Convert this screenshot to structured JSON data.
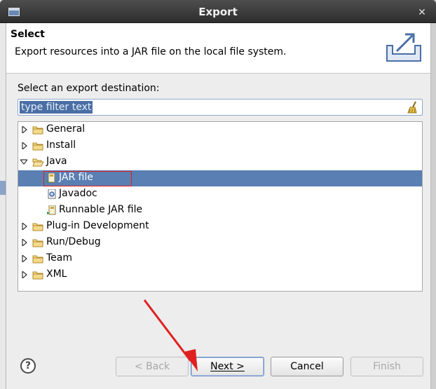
{
  "window": {
    "title": "Export"
  },
  "header": {
    "title": "Select",
    "description": "Export resources into a JAR file on the local file system."
  },
  "destination_label": "Select an export destination:",
  "filter": {
    "value": "type filter text"
  },
  "tree": {
    "items": [
      {
        "label": "General",
        "expanded": false,
        "level": 0
      },
      {
        "label": "Install",
        "expanded": false,
        "level": 0
      },
      {
        "label": "Java",
        "expanded": true,
        "level": 0
      },
      {
        "label": "JAR file",
        "level": 1,
        "selected": true
      },
      {
        "label": "Javadoc",
        "level": 1
      },
      {
        "label": "Runnable JAR file",
        "level": 1
      },
      {
        "label": "Plug-in Development",
        "expanded": false,
        "level": 0
      },
      {
        "label": "Run/Debug",
        "expanded": false,
        "level": 0
      },
      {
        "label": "Team",
        "expanded": false,
        "level": 0
      },
      {
        "label": "XML",
        "expanded": false,
        "level": 0
      }
    ]
  },
  "buttons": {
    "back": "< Back",
    "next": "Next >",
    "cancel": "Cancel",
    "finish": "Finish"
  },
  "help_label": "?",
  "colors": {
    "selection": "#5a7fb3",
    "annotation": "#e02020",
    "filter_highlight": "#4a6fa5"
  }
}
